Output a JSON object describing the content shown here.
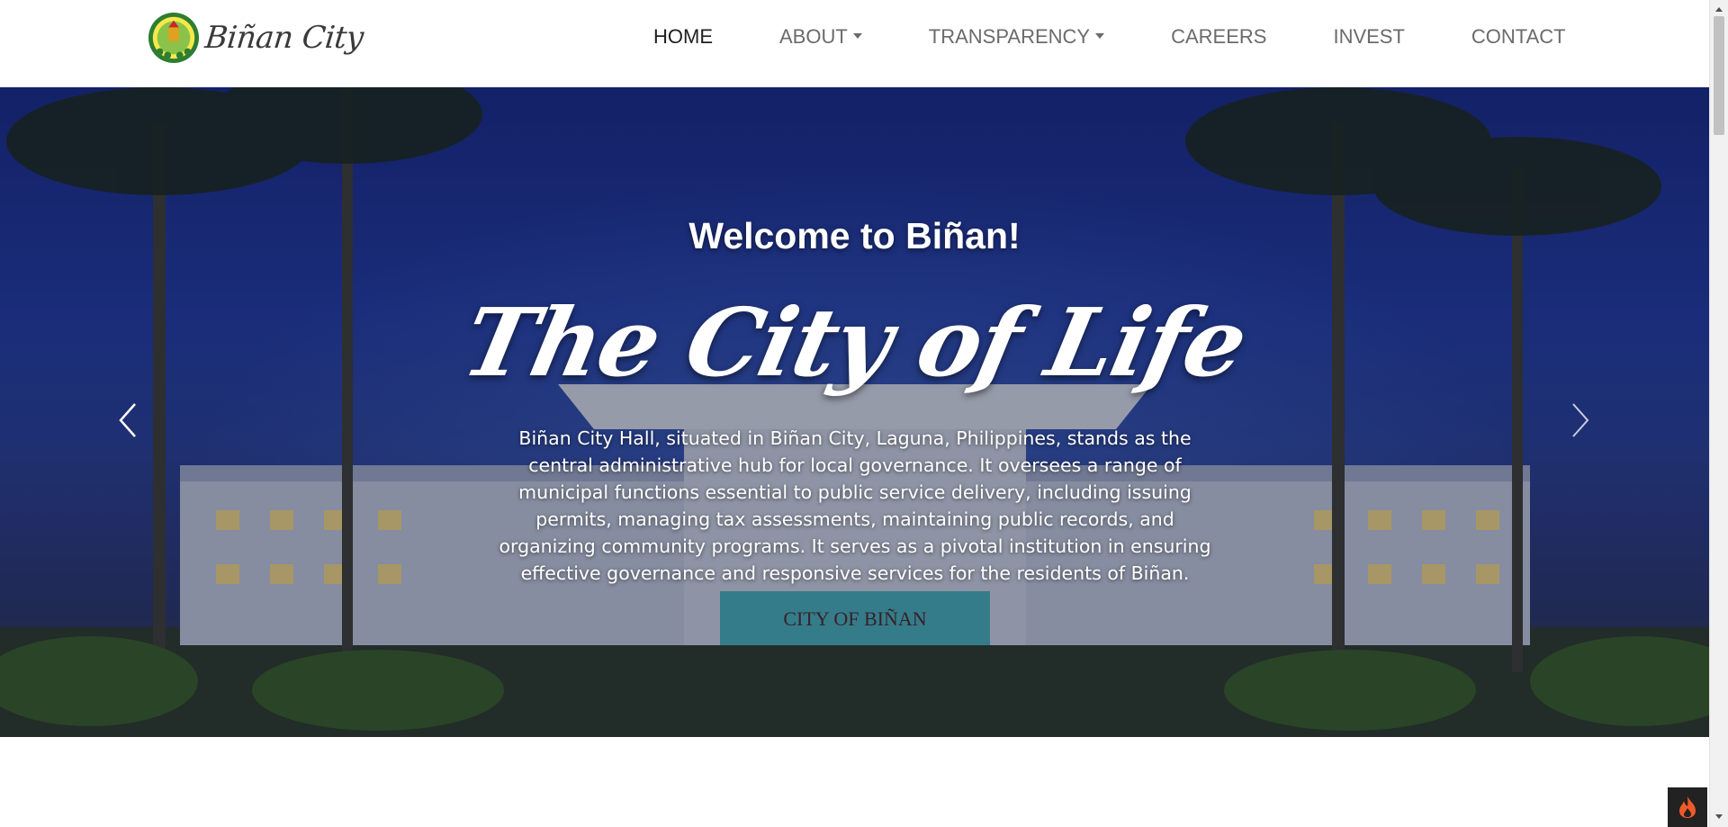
{
  "brand": {
    "name": "Biñan City",
    "logo": "city-seal-icon"
  },
  "nav": {
    "items": [
      {
        "label": "HOME",
        "active": true,
        "dropdown": false
      },
      {
        "label": "ABOUT",
        "active": false,
        "dropdown": true
      },
      {
        "label": "TRANSPARENCY",
        "active": false,
        "dropdown": true
      },
      {
        "label": "CAREERS",
        "active": false,
        "dropdown": false
      },
      {
        "label": "INVEST",
        "active": false,
        "dropdown": false
      },
      {
        "label": "CONTACT",
        "active": false,
        "dropdown": false
      }
    ]
  },
  "hero": {
    "welcome": "Welcome to Biñan!",
    "tagline": "The City of Life",
    "description": "Biñan City Hall, situated in Biñan City, Laguna, Philippines, stands as the central administrative hub for local governance. It oversees a range of municipal functions essential to public service delivery, including issuing permits, managing tax assessments, maintaining public records, and organizing community programs. It serves as a pivotal institution in ensuring effective governance and responsive services for the residents of Biñan.",
    "building_sign": "CITY OF BIÑAN",
    "prev_icon": "chevron-left-icon",
    "next_icon": "chevron-right-icon"
  },
  "fab": {
    "icon": "flame-icon"
  },
  "colors": {
    "nav_text": "#6b6b6b",
    "nav_active": "#1f1f1f",
    "hero_sky": "#233a9a",
    "fab_bg": "#222222",
    "flame": "#f05a28"
  }
}
